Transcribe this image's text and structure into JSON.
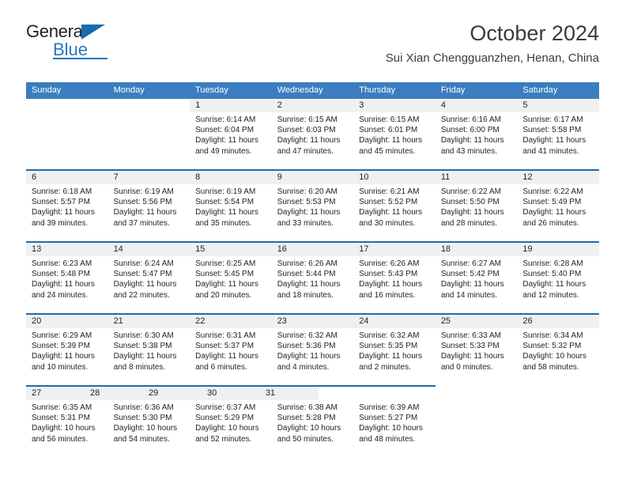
{
  "brand": {
    "name_primary": "General",
    "name_secondary": "Blue",
    "logo_icon": "triangle-flag-icon"
  },
  "header": {
    "title": "October 2024",
    "subtitle": "Sui Xian Chengguanzhen, Henan, China"
  },
  "colors": {
    "header_blue": "#3b7dc0",
    "separator_blue": "#1f6cb0",
    "daynum_band": "#f0f0f0",
    "brand_blue": "#2577bc",
    "text": "#231f20"
  },
  "weekdays": [
    "Sunday",
    "Monday",
    "Tuesday",
    "Wednesday",
    "Thursday",
    "Friday",
    "Saturday"
  ],
  "labels": {
    "sunrise_prefix": "Sunrise:",
    "sunset_prefix": "Sunset:",
    "daylight_prefix": "Daylight:"
  },
  "weeks": [
    {
      "days": [
        {
          "num": "",
          "l1": "",
          "l2": "",
          "l3": "",
          "l4": ""
        },
        {
          "num": "",
          "l1": "",
          "l2": "",
          "l3": "",
          "l4": ""
        },
        {
          "num": "1",
          "l1": "Sunrise: 6:14 AM",
          "l2": "Sunset: 6:04 PM",
          "l3": "Daylight: 11 hours",
          "l4": "and 49 minutes."
        },
        {
          "num": "2",
          "l1": "Sunrise: 6:15 AM",
          "l2": "Sunset: 6:03 PM",
          "l3": "Daylight: 11 hours",
          "l4": "and 47 minutes."
        },
        {
          "num": "3",
          "l1": "Sunrise: 6:15 AM",
          "l2": "Sunset: 6:01 PM",
          "l3": "Daylight: 11 hours",
          "l4": "and 45 minutes."
        },
        {
          "num": "4",
          "l1": "Sunrise: 6:16 AM",
          "l2": "Sunset: 6:00 PM",
          "l3": "Daylight: 11 hours",
          "l4": "and 43 minutes."
        },
        {
          "num": "5",
          "l1": "Sunrise: 6:17 AM",
          "l2": "Sunset: 5:58 PM",
          "l3": "Daylight: 11 hours",
          "l4": "and 41 minutes."
        }
      ]
    },
    {
      "days": [
        {
          "num": "6",
          "l1": "Sunrise: 6:18 AM",
          "l2": "Sunset: 5:57 PM",
          "l3": "Daylight: 11 hours",
          "l4": "and 39 minutes."
        },
        {
          "num": "7",
          "l1": "Sunrise: 6:19 AM",
          "l2": "Sunset: 5:56 PM",
          "l3": "Daylight: 11 hours",
          "l4": "and 37 minutes."
        },
        {
          "num": "8",
          "l1": "Sunrise: 6:19 AM",
          "l2": "Sunset: 5:54 PM",
          "l3": "Daylight: 11 hours",
          "l4": "and 35 minutes."
        },
        {
          "num": "9",
          "l1": "Sunrise: 6:20 AM",
          "l2": "Sunset: 5:53 PM",
          "l3": "Daylight: 11 hours",
          "l4": "and 33 minutes."
        },
        {
          "num": "10",
          "l1": "Sunrise: 6:21 AM",
          "l2": "Sunset: 5:52 PM",
          "l3": "Daylight: 11 hours",
          "l4": "and 30 minutes."
        },
        {
          "num": "11",
          "l1": "Sunrise: 6:22 AM",
          "l2": "Sunset: 5:50 PM",
          "l3": "Daylight: 11 hours",
          "l4": "and 28 minutes."
        },
        {
          "num": "12",
          "l1": "Sunrise: 6:22 AM",
          "l2": "Sunset: 5:49 PM",
          "l3": "Daylight: 11 hours",
          "l4": "and 26 minutes."
        }
      ]
    },
    {
      "days": [
        {
          "num": "13",
          "l1": "Sunrise: 6:23 AM",
          "l2": "Sunset: 5:48 PM",
          "l3": "Daylight: 11 hours",
          "l4": "and 24 minutes."
        },
        {
          "num": "14",
          "l1": "Sunrise: 6:24 AM",
          "l2": "Sunset: 5:47 PM",
          "l3": "Daylight: 11 hours",
          "l4": "and 22 minutes."
        },
        {
          "num": "15",
          "l1": "Sunrise: 6:25 AM",
          "l2": "Sunset: 5:45 PM",
          "l3": "Daylight: 11 hours",
          "l4": "and 20 minutes."
        },
        {
          "num": "16",
          "l1": "Sunrise: 6:26 AM",
          "l2": "Sunset: 5:44 PM",
          "l3": "Daylight: 11 hours",
          "l4": "and 18 minutes."
        },
        {
          "num": "17",
          "l1": "Sunrise: 6:26 AM",
          "l2": "Sunset: 5:43 PM",
          "l3": "Daylight: 11 hours",
          "l4": "and 16 minutes."
        },
        {
          "num": "18",
          "l1": "Sunrise: 6:27 AM",
          "l2": "Sunset: 5:42 PM",
          "l3": "Daylight: 11 hours",
          "l4": "and 14 minutes."
        },
        {
          "num": "19",
          "l1": "Sunrise: 6:28 AM",
          "l2": "Sunset: 5:40 PM",
          "l3": "Daylight: 11 hours",
          "l4": "and 12 minutes."
        }
      ]
    },
    {
      "days": [
        {
          "num": "20",
          "l1": "Sunrise: 6:29 AM",
          "l2": "Sunset: 5:39 PM",
          "l3": "Daylight: 11 hours",
          "l4": "and 10 minutes."
        },
        {
          "num": "21",
          "l1": "Sunrise: 6:30 AM",
          "l2": "Sunset: 5:38 PM",
          "l3": "Daylight: 11 hours",
          "l4": "and 8 minutes."
        },
        {
          "num": "22",
          "l1": "Sunrise: 6:31 AM",
          "l2": "Sunset: 5:37 PM",
          "l3": "Daylight: 11 hours",
          "l4": "and 6 minutes."
        },
        {
          "num": "23",
          "l1": "Sunrise: 6:32 AM",
          "l2": "Sunset: 5:36 PM",
          "l3": "Daylight: 11 hours",
          "l4": "and 4 minutes."
        },
        {
          "num": "24",
          "l1": "Sunrise: 6:32 AM",
          "l2": "Sunset: 5:35 PM",
          "l3": "Daylight: 11 hours",
          "l4": "and 2 minutes."
        },
        {
          "num": "25",
          "l1": "Sunrise: 6:33 AM",
          "l2": "Sunset: 5:33 PM",
          "l3": "Daylight: 11 hours",
          "l4": "and 0 minutes."
        },
        {
          "num": "26",
          "l1": "Sunrise: 6:34 AM",
          "l2": "Sunset: 5:32 PM",
          "l3": "Daylight: 10 hours",
          "l4": "and 58 minutes."
        }
      ]
    },
    {
      "days": [
        {
          "num": "27",
          "l1": "Sunrise: 6:35 AM",
          "l2": "Sunset: 5:31 PM",
          "l3": "Daylight: 10 hours",
          "l4": "and 56 minutes."
        },
        {
          "num": "28",
          "l1": "Sunrise: 6:36 AM",
          "l2": "Sunset: 5:30 PM",
          "l3": "Daylight: 10 hours",
          "l4": "and 54 minutes."
        },
        {
          "num": "29",
          "l1": "Sunrise: 6:37 AM",
          "l2": "Sunset: 5:29 PM",
          "l3": "Daylight: 10 hours",
          "l4": "and 52 minutes."
        },
        {
          "num": "30",
          "l1": "Sunrise: 6:38 AM",
          "l2": "Sunset: 5:28 PM",
          "l3": "Daylight: 10 hours",
          "l4": "and 50 minutes."
        },
        {
          "num": "31",
          "l1": "Sunrise: 6:39 AM",
          "l2": "Sunset: 5:27 PM",
          "l3": "Daylight: 10 hours",
          "l4": "and 48 minutes."
        },
        {
          "num": "",
          "l1": "",
          "l2": "",
          "l3": "",
          "l4": ""
        },
        {
          "num": "",
          "l1": "",
          "l2": "",
          "l3": "",
          "l4": ""
        }
      ]
    }
  ]
}
